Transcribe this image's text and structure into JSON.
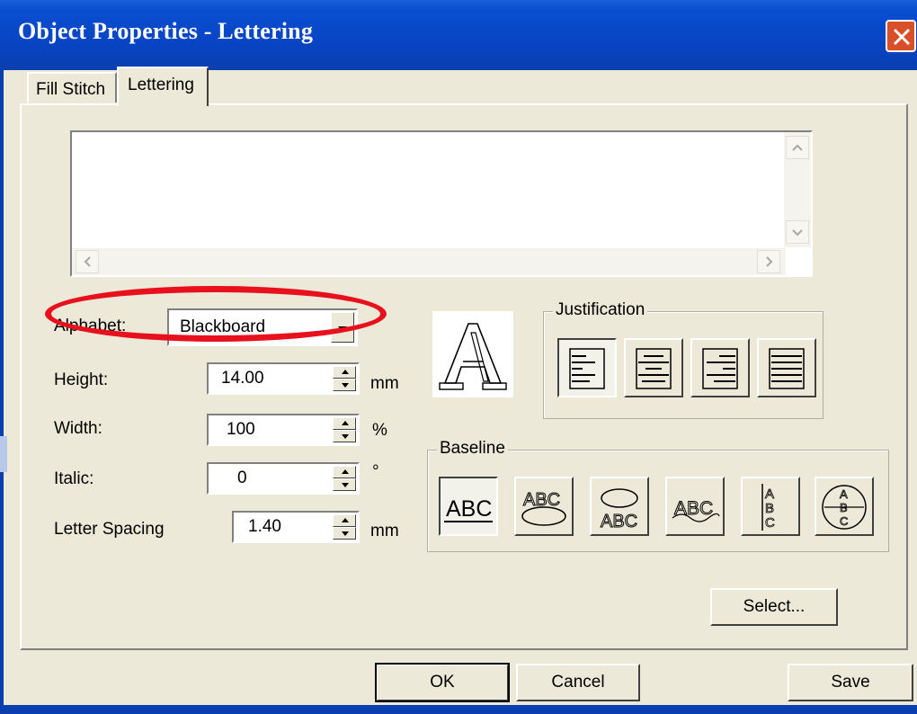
{
  "window": {
    "title": "Object Properties - Lettering",
    "close_glyph": "✕"
  },
  "tabs": [
    {
      "label": "Fill Stitch",
      "selected": false
    },
    {
      "label": "Lettering",
      "selected": true
    }
  ],
  "text_area": {
    "value": ""
  },
  "fields": {
    "alphabet": {
      "label": "Alphabet:",
      "value": "Blackboard"
    },
    "height": {
      "label": "Height:",
      "value": "14.00",
      "unit": "mm"
    },
    "width": {
      "label": "Width:",
      "value": "100",
      "unit": "%"
    },
    "italic": {
      "label": "Italic:",
      "value": "0",
      "unit": "°"
    },
    "letter_spacing": {
      "label": "Letter Spacing",
      "value": "1.40",
      "unit": "mm"
    }
  },
  "justification": {
    "caption": "Justification",
    "options": [
      "align-left-icon",
      "align-center-icon",
      "align-right-icon",
      "align-justify-icon"
    ],
    "selected": 0
  },
  "baseline": {
    "caption": "Baseline",
    "options": [
      "baseline-straight-icon",
      "baseline-ellipse-top-icon",
      "baseline-ellipse-bottom-icon",
      "baseline-wave-icon",
      "baseline-vertical-icon",
      "baseline-circle-stack-icon"
    ],
    "selected": 0
  },
  "buttons": {
    "select": "Select...",
    "ok": "OK",
    "cancel": "Cancel",
    "save": "Save"
  },
  "colors": {
    "titlebar": "#0a4ed0",
    "dialog_bg": "#ece9d8",
    "highlight_oval": "#e8101c"
  }
}
